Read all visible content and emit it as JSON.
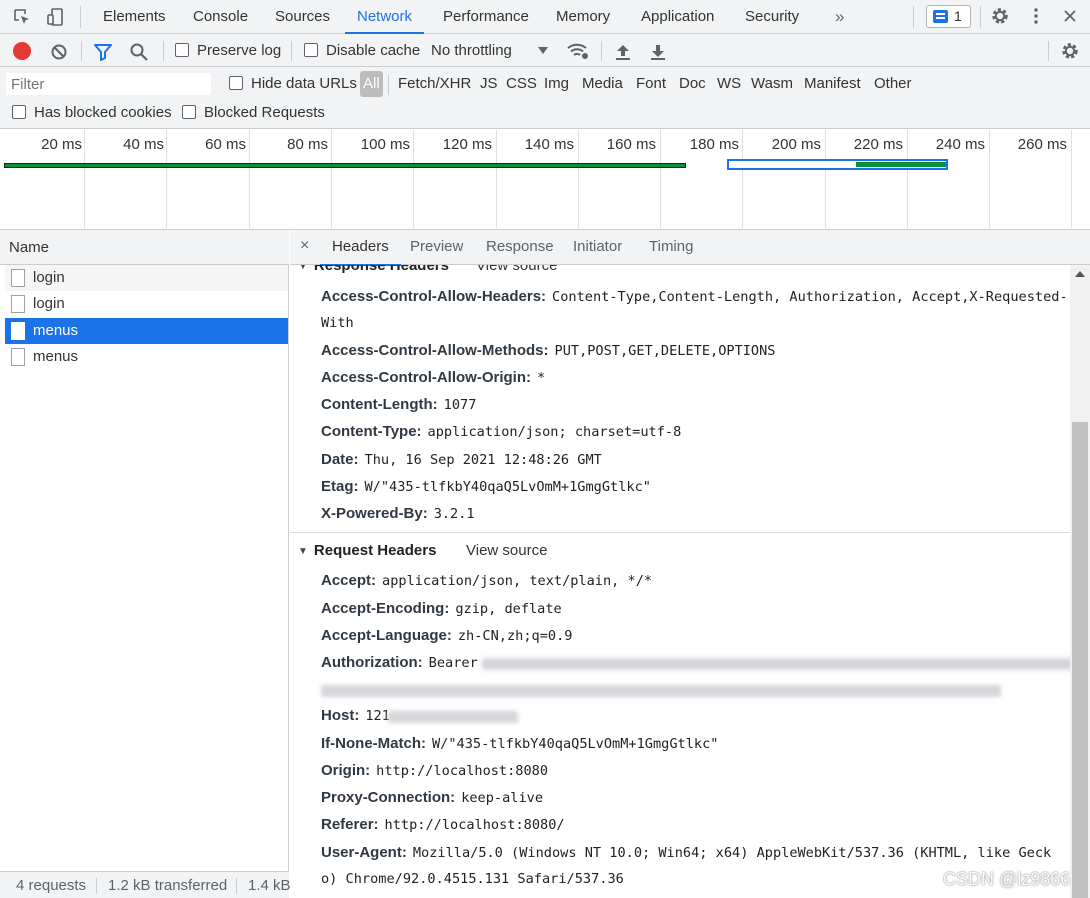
{
  "tabbar": {
    "tabs": [
      "Elements",
      "Console",
      "Sources",
      "Network",
      "Performance",
      "Memory",
      "Application",
      "Security"
    ],
    "active_tab": "Network",
    "more_label": "»",
    "issues_count": "1"
  },
  "toolbar": {
    "preserve_log": "Preserve log",
    "disable_cache": "Disable cache",
    "throttling": "No throttling"
  },
  "filter": {
    "placeholder": "Filter",
    "hide_data_urls": "Hide data URLs",
    "types": [
      "All",
      "Fetch/XHR",
      "JS",
      "CSS",
      "Img",
      "Media",
      "Font",
      "Doc",
      "WS",
      "Wasm",
      "Manifest",
      "Other"
    ],
    "active_type": "All",
    "has_blocked_cookies": "Has blocked cookies",
    "blocked_requests": "Blocked Requests"
  },
  "timeline": {
    "ticks": [
      "20 ms",
      "40 ms",
      "60 ms",
      "80 ms",
      "100 ms",
      "120 ms",
      "140 ms",
      "160 ms",
      "180 ms",
      "200 ms",
      "220 ms",
      "240 ms",
      "260 ms"
    ]
  },
  "requests": {
    "column_name": "Name",
    "items": [
      {
        "name": "login",
        "selected": false
      },
      {
        "name": "login",
        "selected": false
      },
      {
        "name": "menus",
        "selected": true
      },
      {
        "name": "menus",
        "selected": false
      }
    ],
    "status": {
      "count": "4 requests",
      "transferred": "1.2 kB transferred",
      "resources": "1.4 kB"
    }
  },
  "detail": {
    "tabs": [
      "Headers",
      "Preview",
      "Response",
      "Initiator",
      "Timing"
    ],
    "active_tab": "Headers",
    "close_glyph": "×",
    "response_headers": {
      "title": "Response Headers",
      "view_source": "View source",
      "items": [
        {
          "name": "Access-Control-Allow-Headers:",
          "value": "Content-Type,Content-Length, Authorization, Accept,X-Requested-",
          "cont": "With"
        },
        {
          "name": "Access-Control-Allow-Methods:",
          "value": "PUT,POST,GET,DELETE,OPTIONS"
        },
        {
          "name": "Access-Control-Allow-Origin:",
          "value": "*"
        },
        {
          "name": "Content-Length:",
          "value": "1077"
        },
        {
          "name": "Content-Type:",
          "value": "application/json; charset=utf-8"
        },
        {
          "name": "Date:",
          "value": "Thu, 16 Sep 2021 12:48:26 GMT"
        },
        {
          "name": "Etag:",
          "value": "W/\"435-tlfkbY40qaQ5LvOmM+1GmgGtlkc\""
        },
        {
          "name": "X-Powered-By:",
          "value": "3.2.1"
        }
      ]
    },
    "request_headers": {
      "title": "Request Headers",
      "view_source": "View source",
      "items": [
        {
          "name": "Accept:",
          "value": "application/json, text/plain, */*"
        },
        {
          "name": "Accept-Encoding:",
          "value": "gzip, deflate"
        },
        {
          "name": "Accept-Language:",
          "value": "zh-CN,zh;q=0.9"
        },
        {
          "name": "Authorization:",
          "value": "Bearer"
        },
        {
          "name": "Host:",
          "value": "121"
        },
        {
          "name": "If-None-Match:",
          "value": "W/\"435-tlfkbY40qaQ5LvOmM+1GmgGtlkc\""
        },
        {
          "name": "Origin:",
          "value": "http://localhost:8080"
        },
        {
          "name": "Proxy-Connection:",
          "value": "keep-alive"
        },
        {
          "name": "Referer:",
          "value": "http://localhost:8080/"
        },
        {
          "name": "User-Agent:",
          "value": "Mozilla/5.0 (Windows NT 10.0; Win64; x64) AppleWebKit/537.36 (KHTML, like Geck",
          "cont": "o) Chrome/92.0.4515.131 Safari/537.36"
        }
      ]
    }
  },
  "watermark": "CSDN @lz9866",
  "colors": {
    "accent": "#1a73e8",
    "record": "#e53935",
    "timeline_green": "#0a8f3c"
  }
}
